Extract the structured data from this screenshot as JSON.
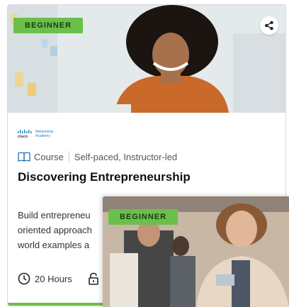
{
  "card1": {
    "badge": "BEGINNER",
    "provider": {
      "logo_text": "cisco",
      "name_line1": "Networking",
      "name_line2": "Academy"
    },
    "type": "Course",
    "delivery": "Self-paced, Instructor-led",
    "title": "Discovering Entrepreneurship",
    "description_lines": [
      "Build entrepreneu",
      "oriented approach",
      "world examples a"
    ],
    "duration": "20 Hours"
  },
  "card2": {
    "badge": "BEGINNER"
  },
  "colors": {
    "badge_green": "#6ac04a",
    "accent_bar": "#6ac04a"
  },
  "icons": [
    "share-icon",
    "book-icon",
    "clock-icon",
    "lock-icon"
  ]
}
